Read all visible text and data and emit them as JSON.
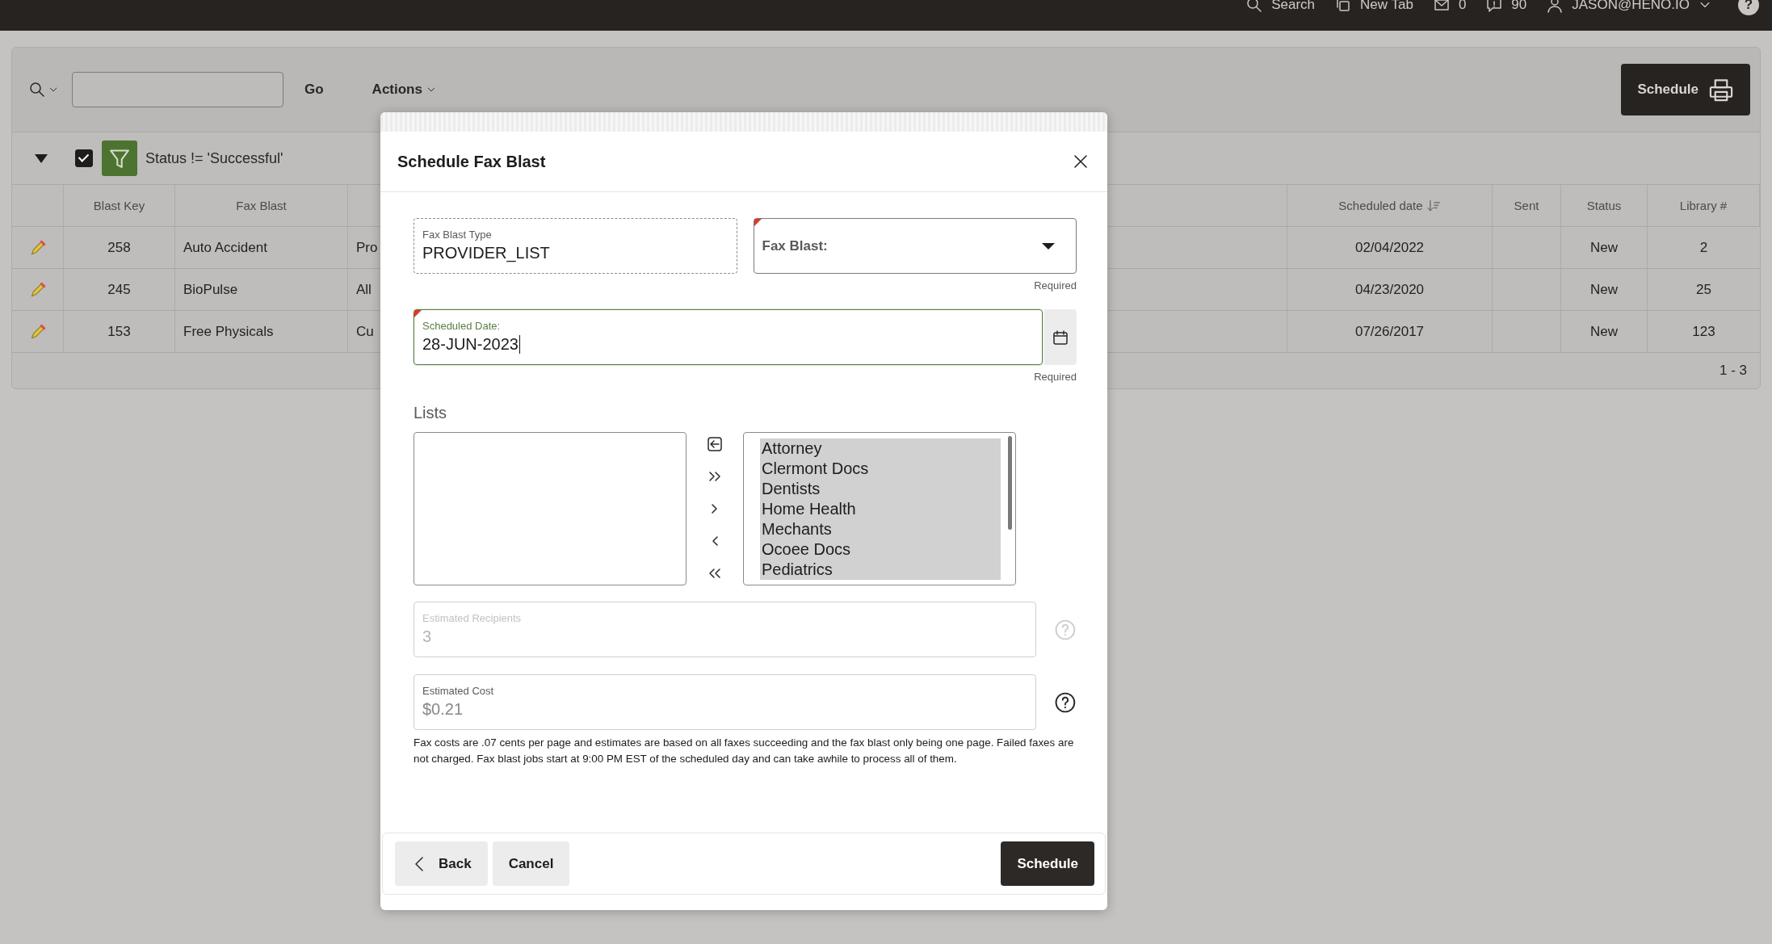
{
  "top_bar": {
    "items": [
      {
        "kind": "search",
        "label": "Search"
      },
      {
        "kind": "tab",
        "label": "New Tab"
      },
      {
        "kind": "mail",
        "label": "0"
      },
      {
        "kind": "chat",
        "label": "90"
      },
      {
        "kind": "user",
        "label": "JASON@HENO.IO"
      }
    ],
    "help": "?"
  },
  "toolbar": {
    "go_button": "Go",
    "actions_menu": "Actions",
    "schedule_button": "Schedule"
  },
  "filter": {
    "expanded": true,
    "enabled": true,
    "text": "Status != 'Successful'"
  },
  "table": {
    "columns": [
      {
        "label": "Blast Key"
      },
      {
        "label": "Fax Blast"
      },
      {},
      {
        "label": "Scheduled date",
        "sorted": true
      },
      {
        "label": "Sent"
      },
      {
        "label": "Status"
      },
      {
        "label": "Library #"
      }
    ],
    "rows": [
      {
        "cells": [
          "258",
          "Auto Accident",
          "Pro",
          "02/04/2022",
          null,
          "New",
          "2"
        ]
      },
      {
        "cells": [
          "245",
          "BioPulse",
          "All",
          "04/23/2020",
          null,
          "New",
          "25"
        ]
      },
      {
        "cells": [
          "153",
          "Free Physicals",
          "Cu",
          "07/26/2017",
          null,
          "New",
          "123"
        ]
      }
    ],
    "pagination": "1 - 3"
  },
  "dialog": {
    "title": "Schedule Fax Blast",
    "fax_blast_type": {
      "label": "Fax Blast Type",
      "value": "PROVIDER_LIST"
    },
    "fax_blast_select": {
      "label": "Fax Blast:",
      "required": true,
      "note": "Required"
    },
    "scheduled_date": {
      "label": "Scheduled Date:",
      "value": "28-JUN-2023",
      "required": true,
      "focused": true,
      "note": "Required"
    },
    "lists": {
      "label": "Lists",
      "chosen": [
        {
          "label": "Attorney",
          "selected": true
        },
        {
          "label": "Clermont Docs",
          "selected": true
        },
        {
          "label": "Dentists",
          "selected": true
        },
        {
          "label": "Home Health",
          "selected": true
        },
        {
          "label": "Mechants",
          "selected": true
        },
        {
          "label": "Ocoee Docs",
          "selected": true
        },
        {
          "label": "Pediatrics",
          "selected": true
        }
      ]
    },
    "estimated_recipients": {
      "label": "Estimated Recipients",
      "value": "3",
      "disabled": true
    },
    "estimated_cost": {
      "label": "Estimated Cost",
      "value": "$0.21",
      "disabled": false
    },
    "note": "Fax costs are .07 cents per page and estimates are based on all faxes succeeding and the fax blast only being one page. Failed faxes are not charged. Fax blast jobs start at 9:00 PM EST of the scheduled day and can take awhile to process all of them.",
    "buttons": [
      {
        "kind": "back",
        "label": "Back"
      },
      {
        "kind": "cancel",
        "label": "Cancel"
      },
      {
        "kind": "primary",
        "label": "Schedule"
      }
    ]
  }
}
